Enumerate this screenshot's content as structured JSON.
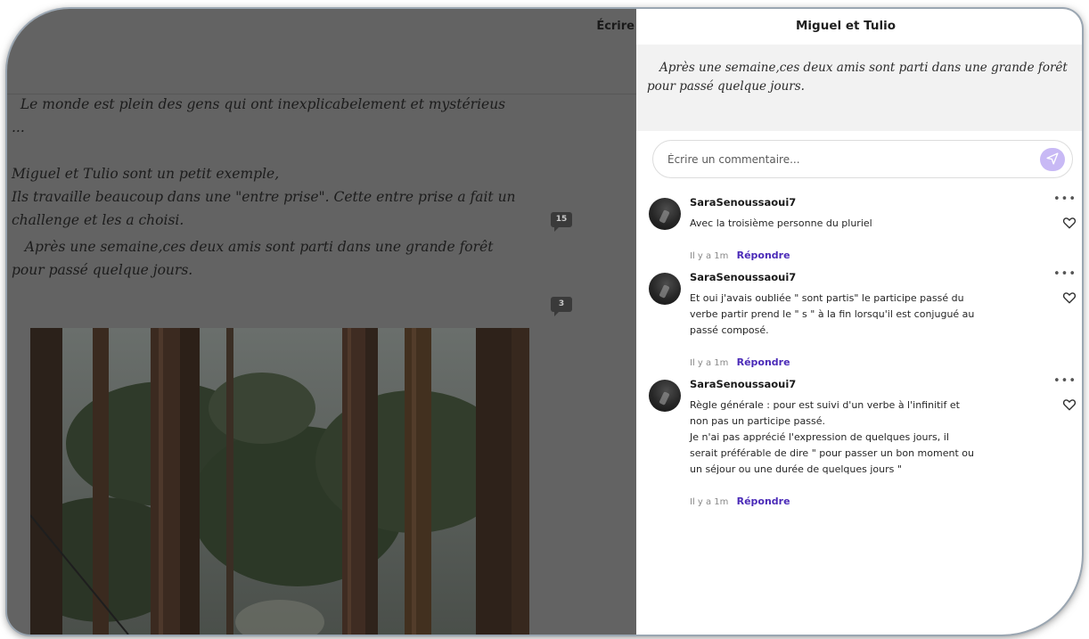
{
  "document": {
    "write_label": "Écrire",
    "paragraphs": [
      "  Le monde est plein des gens qui ont inexplicabelement et mystérieus",
      "...",
      "",
      "Miguel et Tulio sont un petit exemple,",
      "Ils travaille beaucoup dans une \"entre prise\". Cette entre prise a fait un",
      "challenge et les a choisi.",
      "   Après une semaine,ces deux amis sont parti dans une grande forêt",
      "pour passé quelque jours."
    ],
    "comment_badges": [
      "15",
      "3"
    ]
  },
  "panel": {
    "title": "Miguel et Tulio",
    "quote": "Après une semaine,ces deux amis sont parti dans une grande forêt pour passé quelque jours.",
    "comment_placeholder": "Écrire un commentaire...",
    "accent": "#4b2bb8"
  },
  "comments": [
    {
      "author": "SaraSenoussaoui7",
      "body": [
        "Avec la troisième personne du pluriel"
      ],
      "time": "Il y a 1m",
      "reply": "Répondre"
    },
    {
      "author": "SaraSenoussaoui7",
      "body": [
        "Et oui j'avais oubliée \" sont partis\" le participe passé du",
        "verbe partir prend le \" s \" à la fin lorsqu'il est conjugué au",
        "passé composé."
      ],
      "time": "Il y a 1m",
      "reply": "Répondre"
    },
    {
      "author": "SaraSenoussaoui7",
      "body": [
        "Règle générale : pour est suivi d'un verbe à l'infinitif et",
        "non pas un participe passé.",
        "Je n'ai pas apprécié l'expression de quelques jours, il",
        "serait préférable de dire \" pour passer un bon moment ou",
        "un séjour ou une durée de quelques jours \""
      ],
      "time": "Il y a 1m",
      "reply": "Répondre"
    }
  ],
  "icons": {
    "send": "send-icon",
    "like": "heart-icon",
    "more": "more-icon",
    "comment_badge": "comment-badge-icon"
  }
}
